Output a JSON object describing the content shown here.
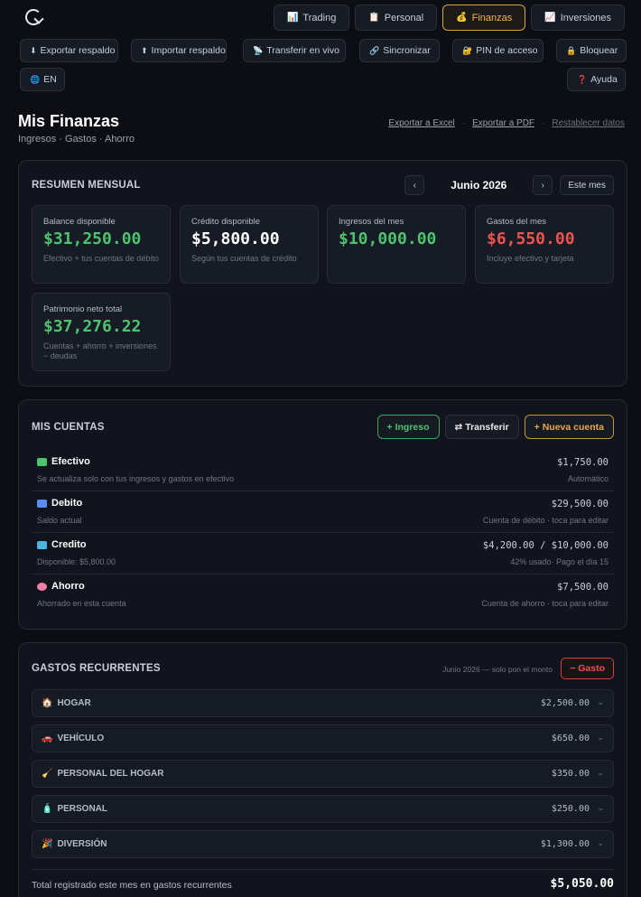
{
  "nav": {
    "tabs": [
      {
        "icon": "📊",
        "label": "Trading"
      },
      {
        "icon": "📋",
        "label": "Personal"
      },
      {
        "icon": "💰",
        "label": "Finanzas"
      },
      {
        "icon": "📈",
        "label": "Inversiones"
      }
    ],
    "active_tab": "Finanzas"
  },
  "actions": {
    "export_backup": "Exportar respaldo",
    "import_backup": "Importar respaldo",
    "live_transfer": "Transferir en vivo",
    "sync": "Sincronizar",
    "pin": "PIN de acceso",
    "lock": "Bloquear",
    "lang": "EN",
    "help": "Ayuda"
  },
  "header": {
    "title": "Mis Finanzas",
    "subtitle": "Ingresos · Gastos · Ahorro",
    "export_excel": "Exportar a Excel",
    "export_pdf": "Exportar a PDF",
    "reset": "Restablecer datos"
  },
  "summary": {
    "title": "RESUMEN MENSUAL",
    "prev": "‹",
    "month": "Junio 2026",
    "next": "›",
    "this_month": "Este mes",
    "cards": [
      {
        "label": "Balance disponible",
        "value": "$31,250.00",
        "note": "Efectivo + tus cuentas de débito"
      },
      {
        "label": "Crédito disponible",
        "value": "$5,800.00",
        "note": "Según tus cuentas de crédito"
      },
      {
        "label": "Ingresos del mes",
        "value": "$10,000.00",
        "note": ""
      },
      {
        "label": "Gastos del mes",
        "value": "$6,550.00",
        "note": "Incluye efectivo y tarjeta"
      },
      {
        "label": "Patrimonio neto total",
        "value": "$37,276.22",
        "note": "Cuentas + ahorro + inversiones − deudas"
      }
    ]
  },
  "accounts": {
    "title": "MIS CUENTAS",
    "add_income": "+ Ingreso",
    "transfer": "⇄ Transferir",
    "new_account": "+ Nueva cuenta",
    "items": [
      {
        "name": "Efectivo",
        "desc": "Se actualiza solo con tus ingresos y gastos en efectivo",
        "amount": "$1,750.00",
        "sub": "Automático"
      },
      {
        "name": "Debito",
        "desc": "Saldo actual",
        "amount": "$29,500.00",
        "sub": "Cuenta de débito · toca para editar"
      },
      {
        "name": "Credito",
        "desc": "Disponible: $5,800.00",
        "amount": "$4,200.00 / $10,000.00",
        "sub": "42% usado· Pago el día 15"
      },
      {
        "name": "Ahorro",
        "desc": "Ahorrado en esta cuenta",
        "amount": "$7,500.00",
        "sub": "Cuenta de ahorro · toca para editar"
      }
    ]
  },
  "recurring": {
    "title": "GASTOS RECURRENTES",
    "note": "Junio 2026 — solo pon el monto",
    "add_expense": "− Gasto",
    "items": [
      {
        "icon": "🏠",
        "name": "HOGAR",
        "amount": "$2,500.00"
      },
      {
        "icon": "🚗",
        "name": "VEHÍCULO",
        "amount": "$650.00"
      },
      {
        "icon": "🧹",
        "name": "PERSONAL DEL HOGAR",
        "amount": "$350.00"
      },
      {
        "icon": "🧴",
        "name": "PERSONAL",
        "amount": "$250.00"
      },
      {
        "icon": "🎉",
        "name": "DIVERSIÓN",
        "amount": "$1,300.00"
      }
    ],
    "chevron": "⌄",
    "total_label": "Total registrado este mes en gastos recurrentes",
    "total": "$5,050.00"
  },
  "colors": {
    "accent": "#e8a84a",
    "positive": "#4cc46e",
    "negative": "#ef5350",
    "background": "#0c0e14"
  }
}
